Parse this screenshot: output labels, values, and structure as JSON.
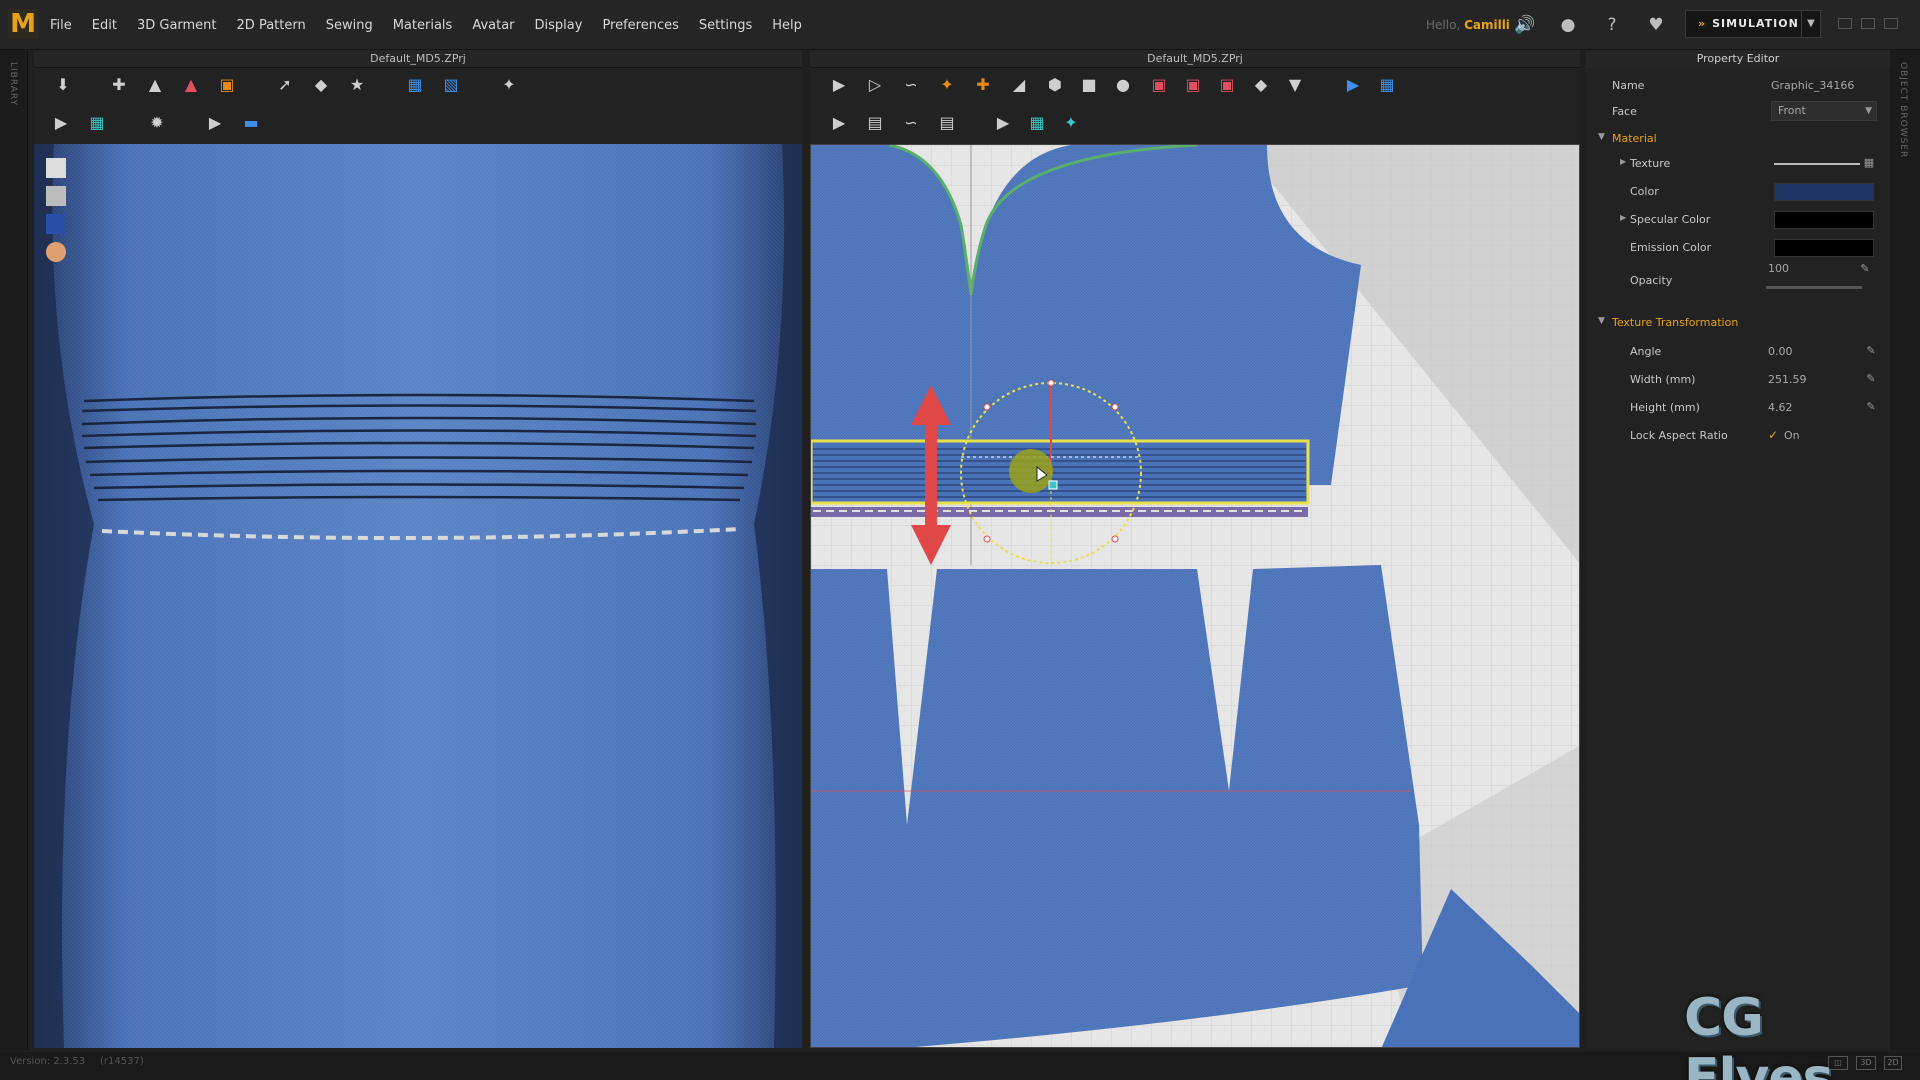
{
  "app": {
    "logo": "M",
    "menus": [
      "File",
      "Edit",
      "3D Garment",
      "2D Pattern",
      "Sewing",
      "Materials",
      "Avatar",
      "Display",
      "Preferences",
      "Settings",
      "Help"
    ],
    "greeting": "Hello,",
    "user": "Camilli",
    "mode_button": "SIMULATION",
    "mode_icon": "chevron-double-icon"
  },
  "left_strip_label": "LIBRARY",
  "right_strip_label": "OBJECT BROWSER",
  "panels": {
    "view3d_title": "Default_MD5.ZPrj",
    "view2d_title": "Default_MD5.ZPrj"
  },
  "property_editor": {
    "title": "Property Editor",
    "name_label": "Name",
    "name_value": "Graphic_34166",
    "face_label": "Face",
    "face_value": "Front",
    "material_section": "Material",
    "texture_label": "Texture",
    "color_label": "Color",
    "color_value": "#1f3566",
    "specular_label": "Specular Color",
    "specular_value": "#000000",
    "emission_label": "Emission Color",
    "emission_value": "#000000",
    "opacity_label": "Opacity",
    "opacity_value": "100",
    "transform_section": "Texture Transformation",
    "angle_label": "Angle",
    "angle_value": "0.00",
    "width_label": "Width (mm)",
    "width_value": "251.59",
    "height_label": "Height (mm)",
    "height_value": "4.62",
    "lock_label": "Lock Aspect Ratio",
    "lock_value": "On"
  },
  "status": {
    "version": "Version: 2.3.53",
    "build": "(r14537)"
  },
  "watermark": "CG Elves",
  "colors": {
    "accent": "#e8a21a",
    "fabric": "#4a72b8",
    "selection": "#e8e04a",
    "arrow": "#e04848"
  }
}
